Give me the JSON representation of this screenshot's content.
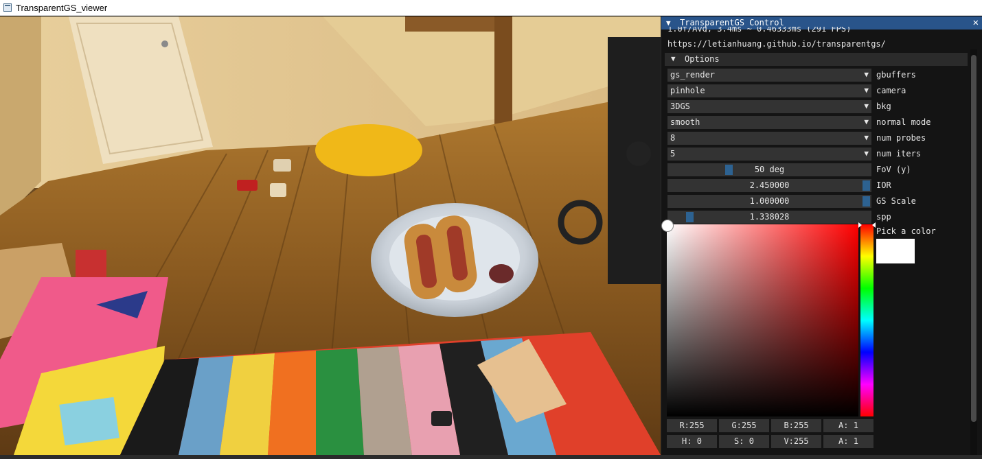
{
  "window": {
    "title": "TransparentGS_viewer"
  },
  "panel": {
    "title": "TransparentGS Control",
    "fps_text": "1.0f/Avg, 3.4ms ~ 0.46333ms (291 FPS)",
    "url": "https://letianhuang.github.io/transparentgs/",
    "options_header": "Options",
    "combos": [
      {
        "value": "gs_render",
        "label": "gbuffers"
      },
      {
        "value": "pinhole",
        "label": "camera"
      },
      {
        "value": "3DGS",
        "label": "bkg"
      },
      {
        "value": "smooth",
        "label": "normal mode"
      },
      {
        "value": "8",
        "label": "num probes"
      },
      {
        "value": "5",
        "label": "num iters"
      }
    ],
    "sliders": [
      {
        "value": "50 deg",
        "label": "FoV (y)",
        "fraction": 0.29
      },
      {
        "value": "2.450000",
        "label": "IOR",
        "fraction": 1.0
      },
      {
        "value": "1.000000",
        "label": "GS Scale",
        "fraction": 1.0
      },
      {
        "value": "1.338028",
        "label": "spp",
        "fraction": 0.09
      }
    ],
    "color_picker": {
      "label": "Pick a color",
      "color": "#ffffff",
      "rgb": [
        "R:255",
        "G:255",
        "B:255",
        "A:  1"
      ],
      "hsv": [
        "H:  0",
        "S:  0",
        "V:255",
        "A:  1"
      ]
    }
  },
  "colors": {
    "header": "#29548a",
    "frame": "#333333",
    "grab": "#2d6291"
  },
  "icons": {
    "collapse": "triangle-down-icon",
    "close": "close-icon",
    "combo_arrow": "triangle-down-icon"
  }
}
